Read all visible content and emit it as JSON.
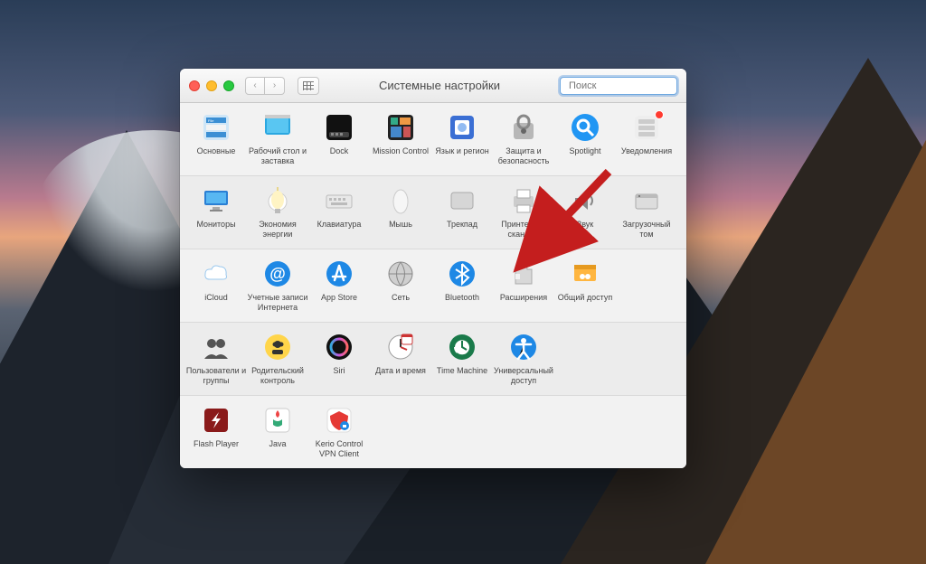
{
  "window": {
    "title": "Системные настройки",
    "search_placeholder": "Поиск"
  },
  "rows": [
    [
      {
        "id": "general",
        "label": "Основные",
        "icon": "general"
      },
      {
        "id": "desktop",
        "label": "Рабочий стол и заставка",
        "icon": "desktop"
      },
      {
        "id": "dock",
        "label": "Dock",
        "icon": "dock"
      },
      {
        "id": "mission",
        "label": "Mission Control",
        "icon": "mission"
      },
      {
        "id": "language",
        "label": "Язык и регион",
        "icon": "language"
      },
      {
        "id": "security",
        "label": "Защита и безопасность",
        "icon": "security"
      },
      {
        "id": "spotlight",
        "label": "Spotlight",
        "icon": "spotlight"
      },
      {
        "id": "notifications",
        "label": "Уведомления",
        "icon": "notifications",
        "badge": true
      }
    ],
    [
      {
        "id": "displays",
        "label": "Мониторы",
        "icon": "displays"
      },
      {
        "id": "energy",
        "label": "Экономия энергии",
        "icon": "energy"
      },
      {
        "id": "keyboard",
        "label": "Клавиатура",
        "icon": "keyboard"
      },
      {
        "id": "mouse",
        "label": "Мышь",
        "icon": "mouse"
      },
      {
        "id": "trackpad",
        "label": "Трекпад",
        "icon": "trackpad"
      },
      {
        "id": "printers",
        "label": "Принтеры и сканеры",
        "icon": "printers"
      },
      {
        "id": "sound",
        "label": "Звук",
        "icon": "sound"
      },
      {
        "id": "startup",
        "label": "Загрузочный том",
        "icon": "startup"
      }
    ],
    [
      {
        "id": "icloud",
        "label": "iCloud",
        "icon": "icloud"
      },
      {
        "id": "internet",
        "label": "Учетные записи Интернета",
        "icon": "internet"
      },
      {
        "id": "appstore",
        "label": "App Store",
        "icon": "appstore"
      },
      {
        "id": "network",
        "label": "Сеть",
        "icon": "network"
      },
      {
        "id": "bluetooth",
        "label": "Bluetooth",
        "icon": "bluetooth"
      },
      {
        "id": "extensions",
        "label": "Расширения",
        "icon": "extensions"
      },
      {
        "id": "sharing",
        "label": "Общий доступ",
        "icon": "sharing"
      }
    ],
    [
      {
        "id": "users",
        "label": "Пользователи и группы",
        "icon": "users"
      },
      {
        "id": "parental",
        "label": "Родительский контроль",
        "icon": "parental"
      },
      {
        "id": "siri",
        "label": "Siri",
        "icon": "siri"
      },
      {
        "id": "datetime",
        "label": "Дата и время",
        "icon": "datetime"
      },
      {
        "id": "timemachine",
        "label": "Time Machine",
        "icon": "timemachine"
      },
      {
        "id": "accessibility",
        "label": "Универсальный доступ",
        "icon": "accessibility"
      }
    ],
    [
      {
        "id": "flash",
        "label": "Flash Player",
        "icon": "flash"
      },
      {
        "id": "java",
        "label": "Java",
        "icon": "java"
      },
      {
        "id": "kerio",
        "label": "Kerio Control VPN Client",
        "icon": "kerio"
      }
    ]
  ],
  "annotation": {
    "type": "arrow",
    "target": "extensions"
  }
}
